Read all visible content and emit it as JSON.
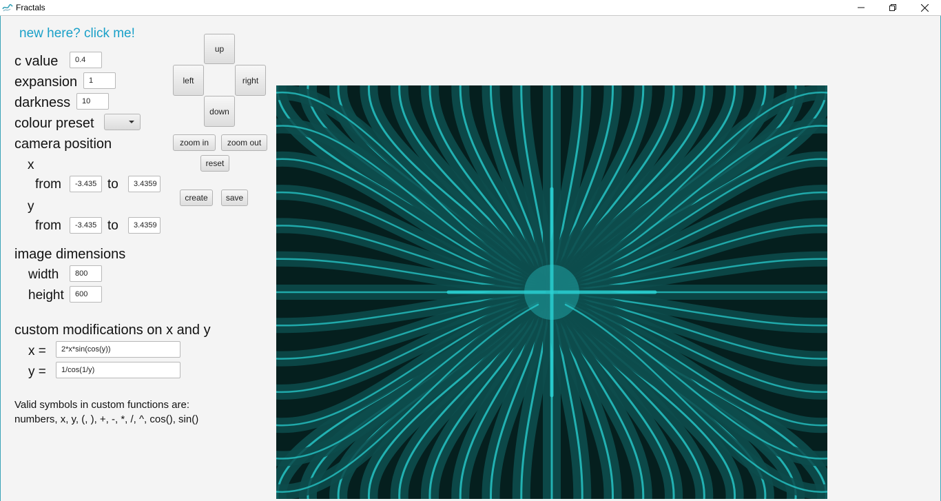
{
  "window": {
    "title": "Fractals"
  },
  "help_link": "new here? click me!",
  "params": {
    "c_value_label": "c value",
    "c_value": "0.4",
    "expansion_label": "expansion",
    "expansion": "1",
    "darkness_label": "darkness",
    "darkness": "10",
    "colour_preset_label": "colour preset",
    "colour_preset_value": ""
  },
  "camera": {
    "label": "camera position",
    "x_label": "x",
    "y_label": "y",
    "from_label": "from",
    "to_label": "to",
    "x_from": "-3.435",
    "x_to": "3.4359",
    "y_from": "-3.435",
    "y_to": "3.4359"
  },
  "dimensions": {
    "label": "image dimensions",
    "width_label": "width",
    "width": "800",
    "height_label": "height",
    "height": "600"
  },
  "custom": {
    "label": "custom modifications on x and y",
    "x_label": "x =",
    "x_expr": "2*x*sin(cos(y))",
    "y_label": "y =",
    "y_expr": "1/cos(1/y)"
  },
  "note": {
    "line1": "Valid symbols in custom functions are:",
    "line2": "numbers, x, y, (, ), +, -, *, /, ^, cos(), sin()"
  },
  "controls": {
    "up": "up",
    "left": "left",
    "right": "right",
    "down": "down",
    "zoom_in": "zoom in",
    "zoom_out": "zoom out",
    "reset": "reset",
    "create": "create",
    "save": "save"
  },
  "colors": {
    "link": "#1aa0c8",
    "fractal_background": "#051f1e",
    "fractal_mid": "#0d4c4c",
    "fractal_bright": "#2ad4d6"
  },
  "icons": {
    "app": "fractal-app-icon",
    "minimize": "minimize-icon",
    "maximize": "restore-icon",
    "close": "close-icon"
  }
}
